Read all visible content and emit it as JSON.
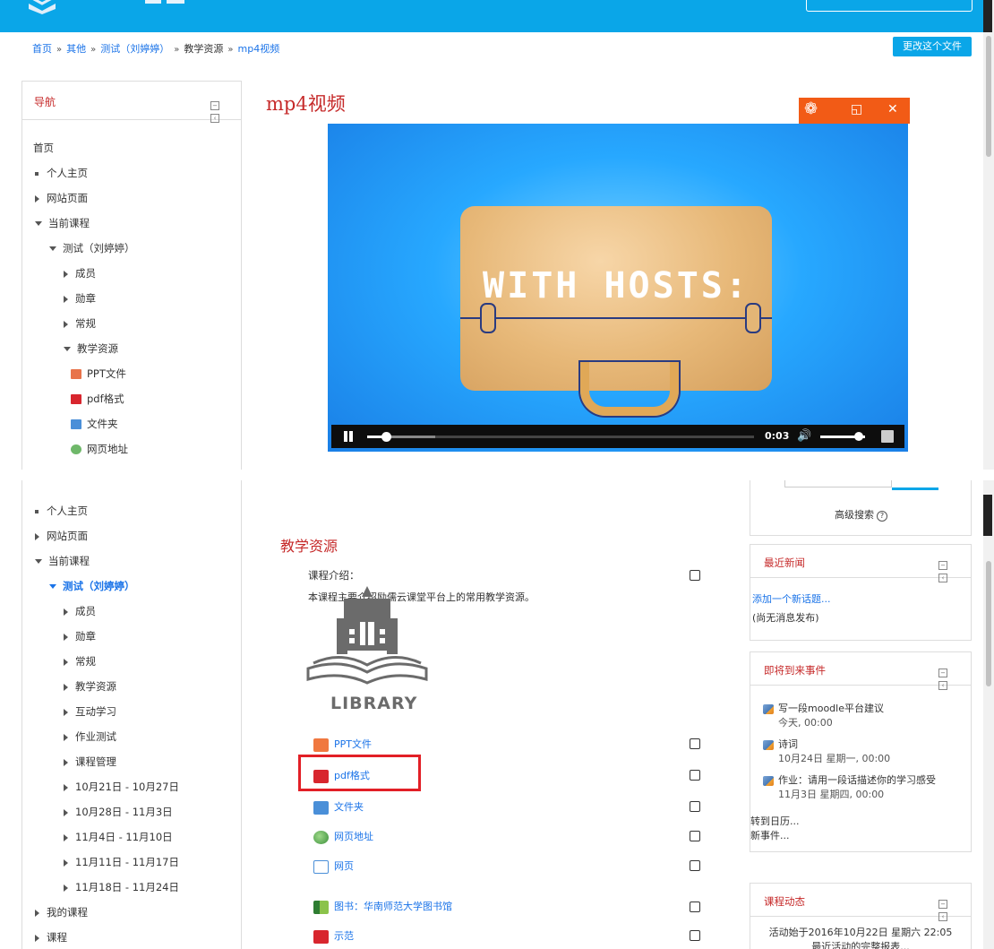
{
  "breadcrumb": {
    "items": [
      "首页",
      "其他",
      "测试（刘婷婷）",
      "教学资源"
    ],
    "current": "mp4视频",
    "separator": "»"
  },
  "header": {
    "edit_button": "更改这个文件"
  },
  "nav": {
    "title": "导航",
    "items_top": {
      "home": "首页",
      "dashboard": "个人主页",
      "site_pages": "网站页面",
      "current_course": "当前课程",
      "course": "测试（刘婷婷）",
      "members": "成员",
      "badges": "勋章",
      "general": "常规",
      "resources": "教学资源",
      "ppt": "PPT文件",
      "pdf": "pdf格式",
      "folder": "文件夹",
      "url": "网页地址"
    },
    "items_bottom": {
      "dashboard": "个人主页",
      "site_pages": "网站页面",
      "current_course": "当前课程",
      "course": "测试（刘婷婷）",
      "members": "成员",
      "badges": "勋章",
      "general": "常规",
      "resources": "教学资源",
      "interactive": "互动学习",
      "assignments": "作业测试",
      "course_admin": "课程管理",
      "week1": "10月21日 - 10月27日",
      "week2": "10月28日 - 11月3日",
      "week3": "11月4日 - 11月10日",
      "week4": "11月11日 - 11月17日",
      "week5": "11月18日 - 11月24日",
      "my_courses": "我的课程",
      "courses": "课程"
    }
  },
  "main": {
    "title": "mp4视频",
    "video": {
      "overlay_text": "WITH HOSTS:",
      "time": "0:03",
      "progress": 0.05,
      "volume": 0.85
    }
  },
  "section": {
    "title": "教学资源",
    "intro_label": "课程介绍：",
    "intro_desc": "本课程主要介绍励儒云课堂平台上的常用教学资源。",
    "library_text": "LIBRARY",
    "resources": [
      "PPT文件",
      "pdf格式",
      "文件夹",
      "网页地址",
      "网页",
      "图书：华南师范大学图书馆",
      "示范"
    ]
  },
  "sidebar": {
    "advanced_search": "高级搜索",
    "news": {
      "title": "最近新闻",
      "add_topic": "添加一个新话题...",
      "empty": "(尚无消息发布)"
    },
    "events": {
      "title": "即将到来事件",
      "items": [
        {
          "name": "写一段moodle平台建议",
          "date": "今天, 00:00"
        },
        {
          "name": "诗词",
          "date": "10月24日 星期一, 00:00"
        },
        {
          "name": "作业：请用一段话描述你的学习感受",
          "date": "11月3日 星期四, 00:00"
        }
      ],
      "goto_calendar": "转到日历...",
      "new_event": "新事件..."
    },
    "activity": {
      "title": "课程动态",
      "since": "活动始于2016年10月22日 星期六 22:05",
      "full_report": "最近活动的完整报表..."
    }
  },
  "colors": {
    "accent": "#0aa6e8",
    "title_red": "#c62a2a",
    "link": "#1a73e8",
    "highlight": "#e21f26"
  }
}
